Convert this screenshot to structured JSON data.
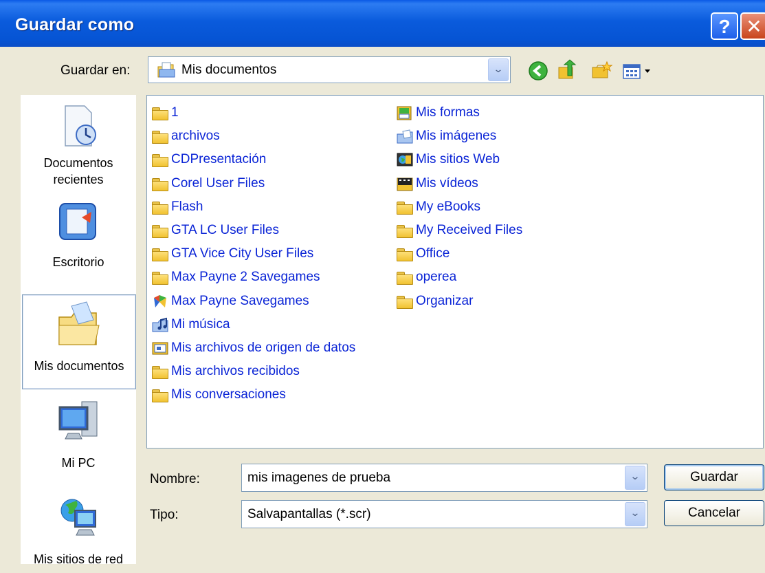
{
  "window": {
    "title": "Guardar como"
  },
  "toolbar": {
    "save_in_label": "Guardar en:",
    "save_in_value": "Mis documentos"
  },
  "places": [
    {
      "label1": "Documentos",
      "label2": "recientes",
      "icon": "recent-documents-icon"
    },
    {
      "label1": "Escritorio",
      "label2": "",
      "icon": "desktop-icon"
    },
    {
      "label1": "Mis documentos",
      "label2": "",
      "icon": "my-documents-icon",
      "selected": true
    },
    {
      "label1": "Mi PC",
      "label2": "",
      "icon": "my-computer-icon"
    },
    {
      "label1": "Mis sitios de red",
      "label2": "",
      "icon": "network-places-icon"
    }
  ],
  "files": {
    "column1": [
      {
        "name": "1",
        "icon": "folder-icon"
      },
      {
        "name": "archivos",
        "icon": "folder-icon"
      },
      {
        "name": "CDPresentación",
        "icon": "folder-icon"
      },
      {
        "name": "Corel User Files",
        "icon": "folder-icon"
      },
      {
        "name": "Flash",
        "icon": "folder-icon"
      },
      {
        "name": "GTA LC User Files",
        "icon": "folder-icon"
      },
      {
        "name": "GTA Vice City User Files",
        "icon": "folder-icon"
      },
      {
        "name": "Max Payne 2 Savegames",
        "icon": "folder-icon"
      },
      {
        "name": "Max Payne Savegames",
        "icon": "max-payne-icon"
      },
      {
        "name": "Mi música",
        "icon": "my-music-icon"
      },
      {
        "name": "Mis archivos de origen de datos",
        "icon": "data-sources-icon"
      },
      {
        "name": "Mis archivos recibidos",
        "icon": "folder-icon"
      },
      {
        "name": "Mis conversaciones",
        "icon": "folder-icon"
      }
    ],
    "column2": [
      {
        "name": "Mis formas",
        "icon": "shapes-folder-icon"
      },
      {
        "name": "Mis imágenes",
        "icon": "my-pictures-icon"
      },
      {
        "name": "Mis sitios Web",
        "icon": "websites-folder-icon"
      },
      {
        "name": "Mis vídeos",
        "icon": "my-videos-icon"
      },
      {
        "name": "My eBooks",
        "icon": "folder-icon"
      },
      {
        "name": "My Received Files",
        "icon": "folder-icon"
      },
      {
        "name": "Office",
        "icon": "folder-icon"
      },
      {
        "name": "operea",
        "icon": "folder-icon"
      },
      {
        "name": "Organizar",
        "icon": "folder-icon"
      }
    ]
  },
  "form": {
    "name_label": "Nombre:",
    "name_value": "mis imagenes de prueba",
    "type_label": "Tipo:",
    "type_value": "Salvapantallas (*.scr)",
    "save_button": "Guardar",
    "cancel_button": "Cancelar"
  },
  "colors": {
    "title_bar": "#0a5bdc",
    "link_text": "#0a24d6",
    "dialog_bg": "#ece9d8"
  }
}
